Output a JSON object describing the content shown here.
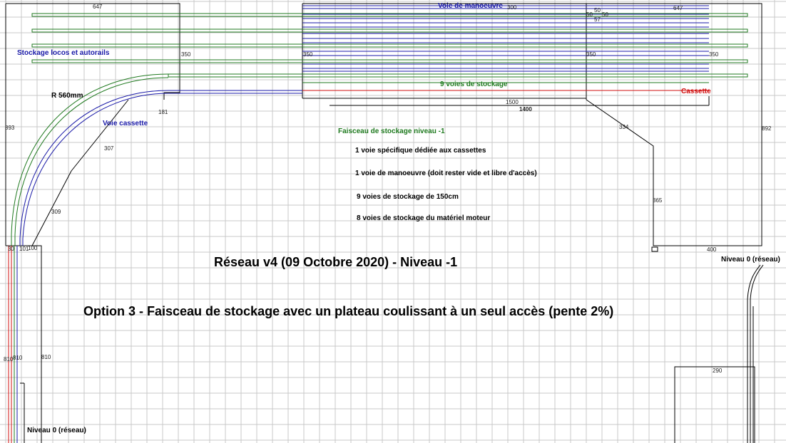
{
  "colors": {
    "grid": "#c8c8c8",
    "outline": "#000000",
    "storage_track": "#1f7a1f",
    "manoeuvre_track": "#1a1aa8",
    "cassette_track": "#d01010"
  },
  "labels": {
    "voie_manoeuvre": "Voie de manoeuvre",
    "stockage_locos": "Stockage locos et autorails",
    "rayon": "R 560mm",
    "voie_cassette": "Voie cassette",
    "neuf_voies": "9 voies de stockage",
    "cassette": "Cassette",
    "faisceau": "Faisceau de stockage niveau -1",
    "niveau0_right": "Niveau 0 (réseau)",
    "niveau0_left": "Niveau 0 (réseau)"
  },
  "notes": [
    "1 voie spécifique dédiée aux cassettes",
    "1 voie de manoeuvre (doit rester vide et libre d'accès)",
    "9 voies de stockage de 150cm",
    "8 voies de stockage du matériel moteur"
  ],
  "titles": {
    "main": "Réseau v4 (09 Octobre 2020) - Niveau -1",
    "option": "Option 3 - Faisceau de stockage avec un plateau coulissant à un seul accès (pente 2%)"
  },
  "dimensions": {
    "d647_left": "647",
    "d647_right": "647",
    "d300": "300",
    "d50a": "50",
    "d50b": "50",
    "d50c": "50",
    "d57": "57",
    "d350_a": "350",
    "d350_b": "350",
    "d350_c": "350",
    "d350_d": "350",
    "d1500": "1500",
    "d1400": "1400",
    "d181": "181",
    "d307": "307",
    "d893": "893",
    "d892": "892",
    "d334": "334",
    "d309": "309",
    "d365": "365",
    "d400": "400",
    "d30": "30",
    "d101": "101",
    "d100": "100",
    "d810a": "810",
    "d810b": "810",
    "d810c": "810",
    "d290": "290"
  }
}
